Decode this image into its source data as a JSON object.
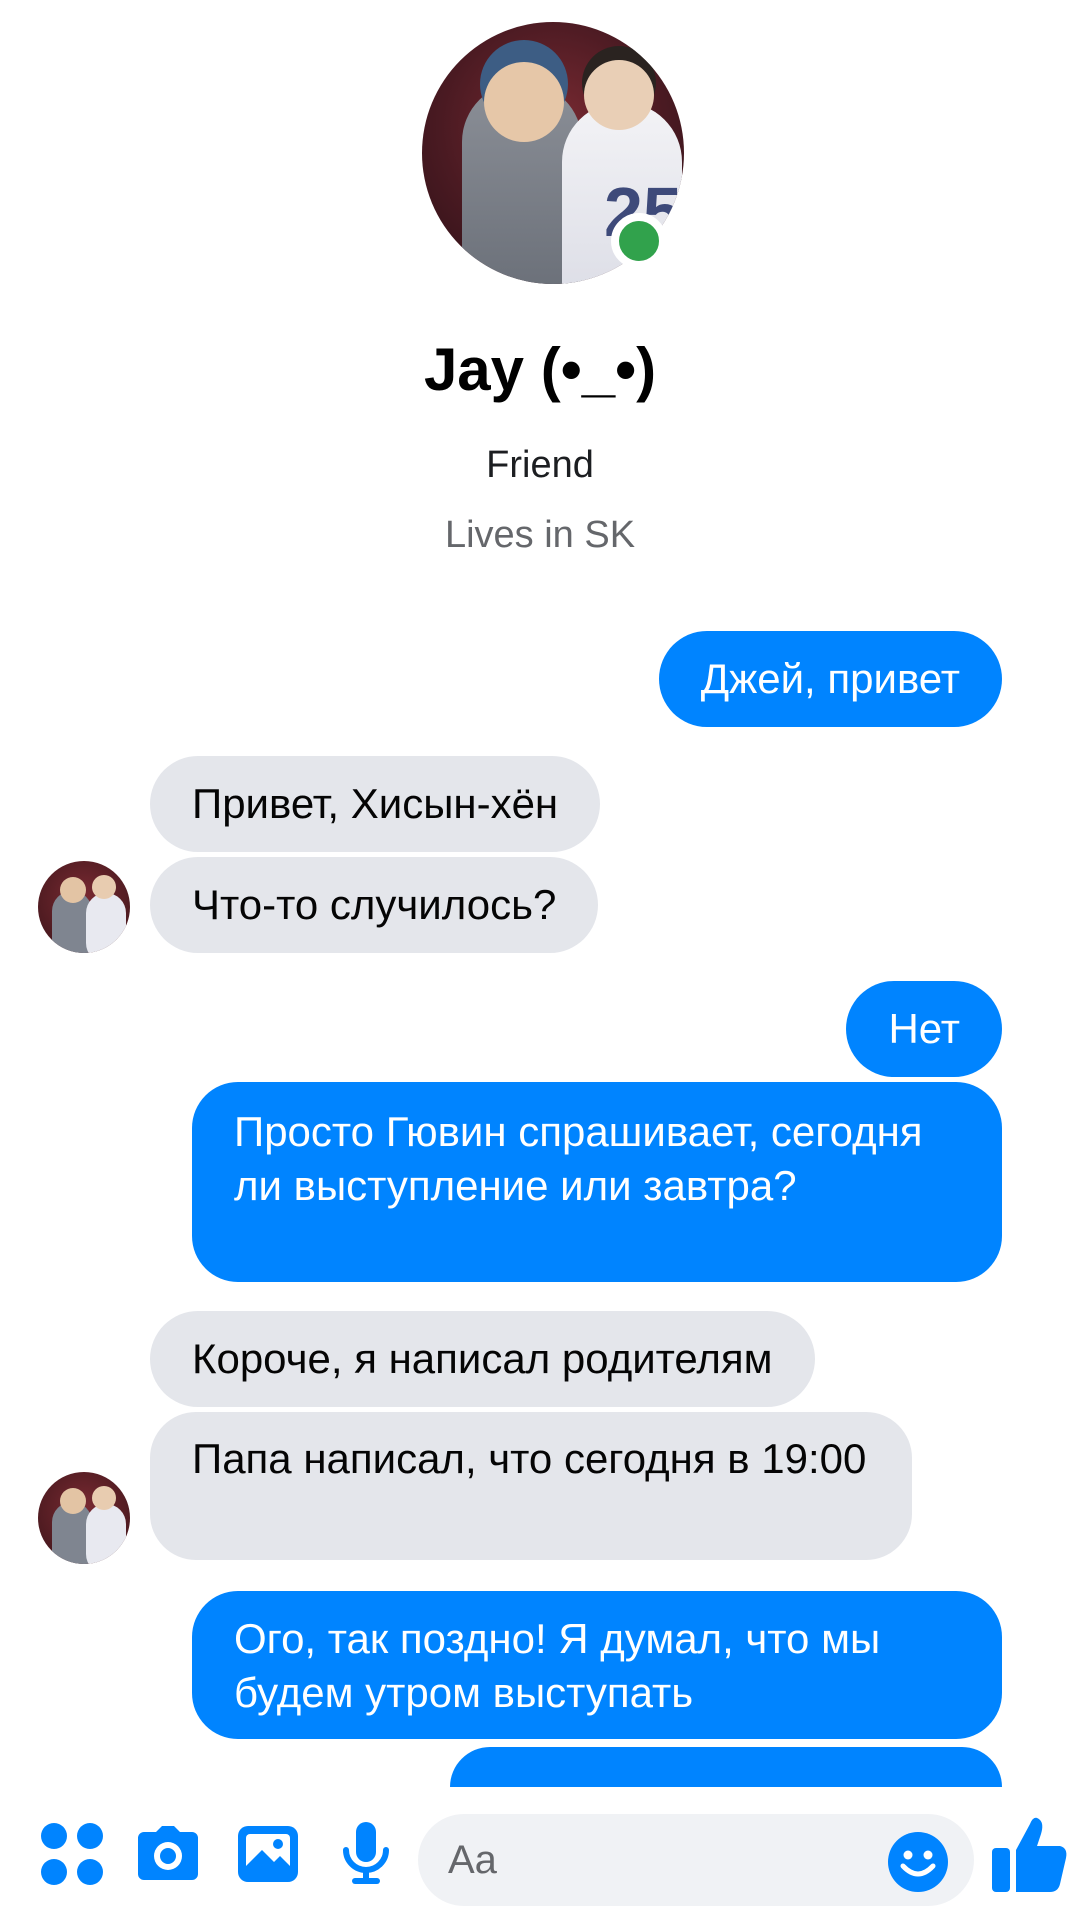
{
  "profile": {
    "name": "Jay (•_•)",
    "relationship": "Friend",
    "location": "Lives in SK",
    "online": true
  },
  "messages": [
    {
      "side": "out",
      "text": "Джей, привет"
    },
    {
      "side": "in",
      "text": "Привет, Хисын-хён"
    },
    {
      "side": "in",
      "text": "Что-то случилось?"
    },
    {
      "side": "out",
      "text": "Нет"
    },
    {
      "side": "out",
      "text": "Просто Гювин спрашивает, сегодня ли выступление или завтра?"
    },
    {
      "side": "in",
      "text": "Короче, я написал родителям"
    },
    {
      "side": "in",
      "text": "Папа написал, что сегодня в 19:00"
    },
    {
      "side": "out",
      "text": "Ого, так поздно! Я думал, что мы будем утром выступать"
    }
  ],
  "composer": {
    "placeholder": "Aa",
    "value": ""
  },
  "colors": {
    "accent": "#0084ff",
    "incoming_bubble": "#e4e6eb",
    "online": "#31a24c"
  },
  "icons": [
    "apps-icon",
    "camera-icon",
    "gallery-icon",
    "microphone-icon",
    "emoji-icon",
    "thumbs-up-icon"
  ]
}
